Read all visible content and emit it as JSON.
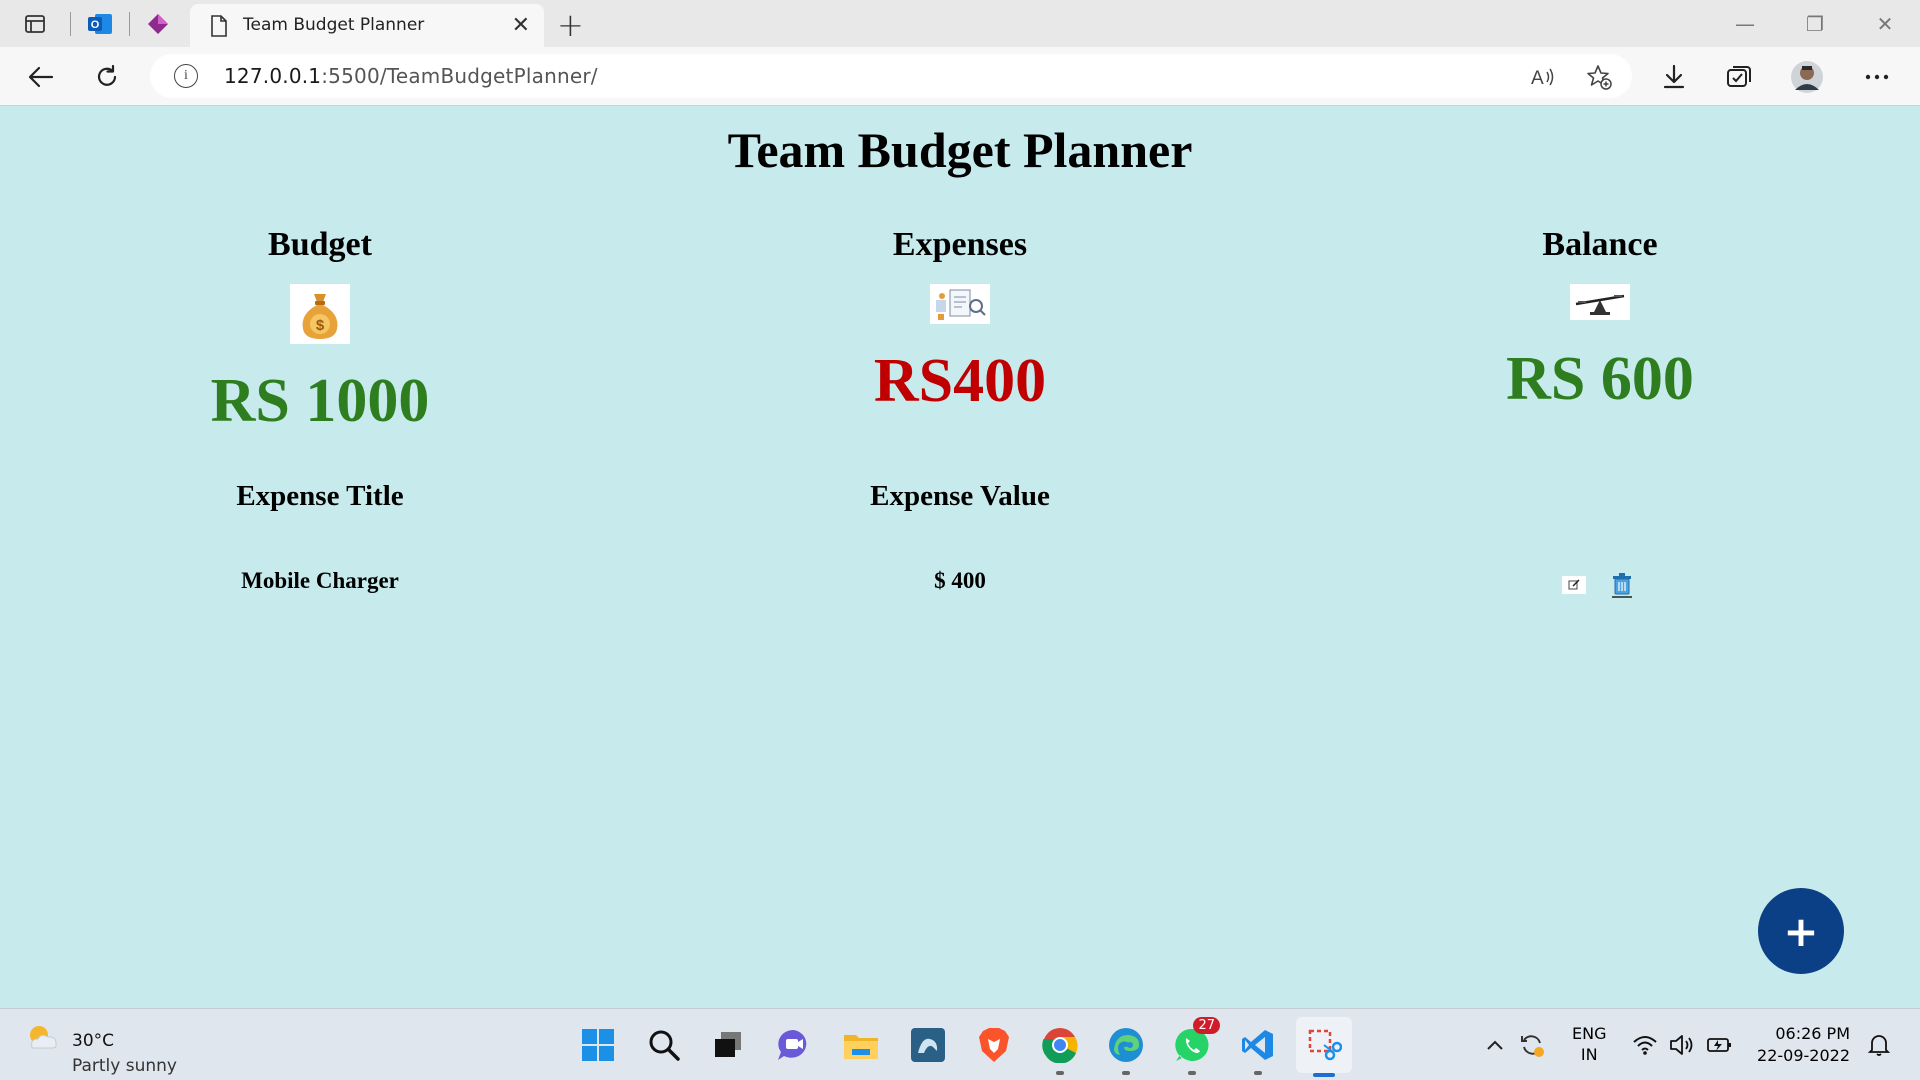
{
  "browser": {
    "tab_title": "Team Budget Planner",
    "url_host": "127.0.0.1",
    "url_rest": ":5500/TeamBudgetPlanner/"
  },
  "page": {
    "title": "Team Budget Planner",
    "budget": {
      "heading": "Budget",
      "amount": "RS 1000",
      "icon": "money-bag-icon",
      "color": "#2e7d1e"
    },
    "expenses": {
      "heading": "Expenses",
      "amount": "RS400",
      "icon": "expense-report-icon",
      "color": "#c00000"
    },
    "balance": {
      "heading": "Balance",
      "amount": "RS 600",
      "icon": "balance-scale-icon",
      "color": "#2e7d1e"
    },
    "table": {
      "headers": [
        "Expense Title",
        "Expense Value"
      ],
      "rows": [
        {
          "title": "Mobile Charger",
          "value": "$ 400"
        }
      ]
    },
    "fab_label": "+"
  },
  "taskbar": {
    "weather_temp": "30°C",
    "weather_desc": "Partly sunny",
    "whatsapp_badge": "27",
    "lang_top": "ENG",
    "lang_bottom": "IN",
    "time": "06:26 PM",
    "date": "22-09-2022"
  }
}
